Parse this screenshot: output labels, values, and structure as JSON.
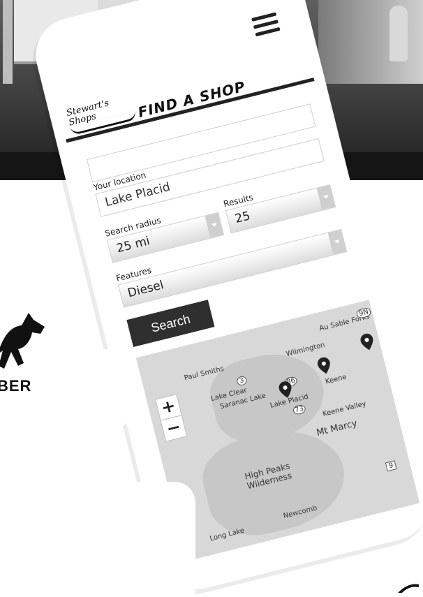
{
  "app": {
    "brand_logo_text": "Stewart's Shops",
    "page_title": "FIND A SHOP"
  },
  "form": {
    "location_label": "Your location",
    "location_value": "Lake Placid",
    "radius_label": "Search radius",
    "radius_value": "25 mi",
    "results_label": "Results",
    "results_value": "25",
    "features_label": "Features",
    "features_value": "Diesel",
    "search_label": "Search"
  },
  "map": {
    "zoom_in": "+",
    "zoom_out": "−",
    "places": [
      "Au Sable Forks",
      "Paul Smiths",
      "Wilmington",
      "Lake Clear",
      "Saranac Lake",
      "Lake Placid",
      "Keene",
      "Keene Valley",
      "Mt Marcy",
      "High Peaks Wilderness",
      "Long Lake",
      "Newcomb"
    ],
    "route_shields": [
      "3",
      "86",
      "73",
      "9N",
      "9"
    ]
  },
  "background": {
    "partial_brand_text": "BER"
  },
  "colors": {
    "header_dark": "#222222",
    "button_bg": "#2f2f2f",
    "map_bg": "#d8d8d8",
    "pin": "#222222"
  }
}
